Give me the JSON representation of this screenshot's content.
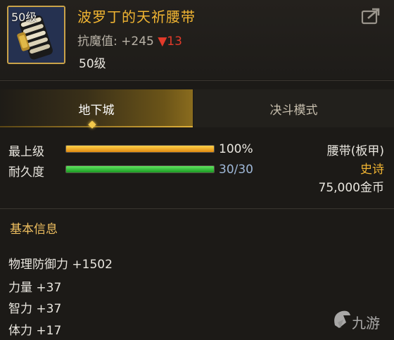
{
  "item": {
    "level_badge": "50级",
    "name": "波罗丁的天祈腰带",
    "stat_label": "抗魔值: +245",
    "stat_change": "▼13",
    "level_requirement": "50级"
  },
  "tabs": [
    {
      "label": "地下城",
      "active": true
    },
    {
      "label": "决斗模式",
      "active": false
    }
  ],
  "bars": [
    {
      "label": "最上级",
      "value_text": "100%",
      "fraction": 1.0,
      "color": "#f0a020"
    },
    {
      "label": "耐久度",
      "value_text": "30/30",
      "fraction": 1.0,
      "color": "#2fc22f"
    }
  ],
  "summary": {
    "type": "腰带(板甲)",
    "rarity": "史诗",
    "price": "75,000金币"
  },
  "section": {
    "title": "基本信息",
    "attributes": [
      "物理防御力 +1502",
      "力量 +37",
      "智力 +37",
      "体力 +17"
    ]
  },
  "watermark": {
    "text": "九游"
  },
  "colors": {
    "gold": "#f0b432",
    "stat_down": "#e23a2a",
    "background": "#1c1a17"
  },
  "icons": {
    "share": "share-icon",
    "item": "belt-item-icon",
    "tab_marker": "diamond-marker-icon"
  }
}
